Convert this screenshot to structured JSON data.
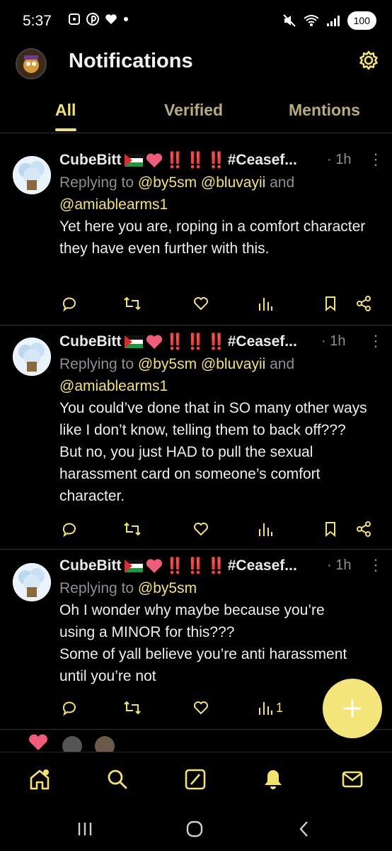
{
  "status_bar": {
    "time": "5:37",
    "battery": "100"
  },
  "header": {
    "title": "Notifications"
  },
  "tabs": [
    {
      "label": "All",
      "active": true
    },
    {
      "label": "Verified",
      "active": false
    },
    {
      "label": "Mentions",
      "active": false
    }
  ],
  "tweets": [
    {
      "name": "CubeBitt",
      "hashtag": "#Ceasef...",
      "time": "1h",
      "replying_label": "Replying to",
      "mentions": [
        "@by5sm",
        "@bluvayii",
        "@amiablearms1"
      ],
      "and_word": "and",
      "text": "Yet here you are, roping in a comfort character they have even further with this.",
      "views": ""
    },
    {
      "name": "CubeBitt",
      "hashtag": "#Ceasef...",
      "time": "1h",
      "replying_label": "Replying to",
      "mentions": [
        "@by5sm",
        "@bluvayii",
        "@amiablearms1"
      ],
      "and_word": "and",
      "text": "You could’ve done that in SO many other ways like I don’t know, telling them to back off??? But no, you just HAD to pull the sexual harassment card on someone’s comfort character.",
      "views": ""
    },
    {
      "name": "CubeBitt",
      "hashtag": "#Ceasef...",
      "time": "1h",
      "replying_label": "Replying to",
      "mentions": [
        "@by5sm"
      ],
      "text_line1": "Oh I wonder why maybe because you’re using a MINOR for this???",
      "text_line2": "Some of yall believe you’re anti harassment until you’re not",
      "views": "1"
    }
  ],
  "icons": {
    "accent": "#f2e46a",
    "bang": "‼️",
    "dot": "·"
  }
}
